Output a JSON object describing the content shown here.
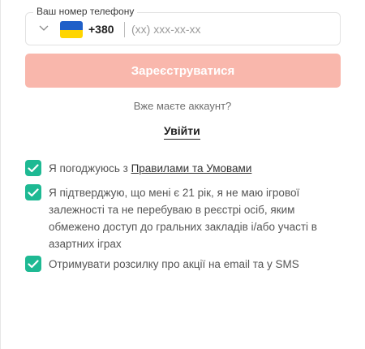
{
  "phone": {
    "label": "Ваш номер телефону",
    "country_code": "+380",
    "placeholder": "(xx) xxx-xx-xx",
    "flag_icon": "ukraine-flag-icon",
    "flag_colors": {
      "top": "#1f5fc8",
      "bottom": "#ffd500"
    }
  },
  "register": {
    "label": "Зареєструватися",
    "color": "#f9b7ac"
  },
  "login": {
    "prompt": "Вже маєте аккаунт?",
    "link": "Увійти"
  },
  "checkboxes": [
    {
      "prefix": "Я погоджуюсь з ",
      "link": "Правилами та Умовами",
      "checked": true
    },
    {
      "text": "Я підтверджую, що мені є 21 рік, я не маю ігрової залежності та не перебуваю в реєстрі осіб, яким обмежено доступ до гральних закладів і/або участі в азартних іграх",
      "checked": true
    },
    {
      "text": "Отримувати розсилку про акції на email та у SMS",
      "checked": true
    }
  ],
  "colors": {
    "checkbox": "#1eb993"
  }
}
